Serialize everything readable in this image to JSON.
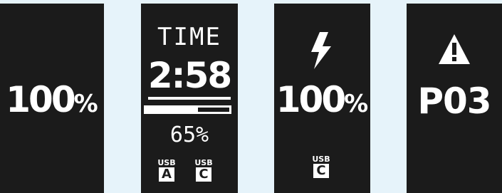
{
  "colors": {
    "background": "#e6f3fa",
    "panel": "#1b1b1b",
    "foreground": "#ffffff"
  },
  "panels": [
    {
      "value_number": "100",
      "value_unit": "%"
    },
    {
      "label": "TIME",
      "time": "2:58",
      "progress": 0.62,
      "percent": "65%",
      "ports": [
        {
          "label": "USB",
          "letter": "A"
        },
        {
          "label": "USB",
          "letter": "C"
        }
      ]
    },
    {
      "icon": "lightning-bolt-icon",
      "value_number": "100",
      "value_unit": "%",
      "ports": [
        {
          "label": "USB",
          "letter": "C"
        }
      ]
    },
    {
      "icon": "warning-icon",
      "code": "P03"
    }
  ]
}
